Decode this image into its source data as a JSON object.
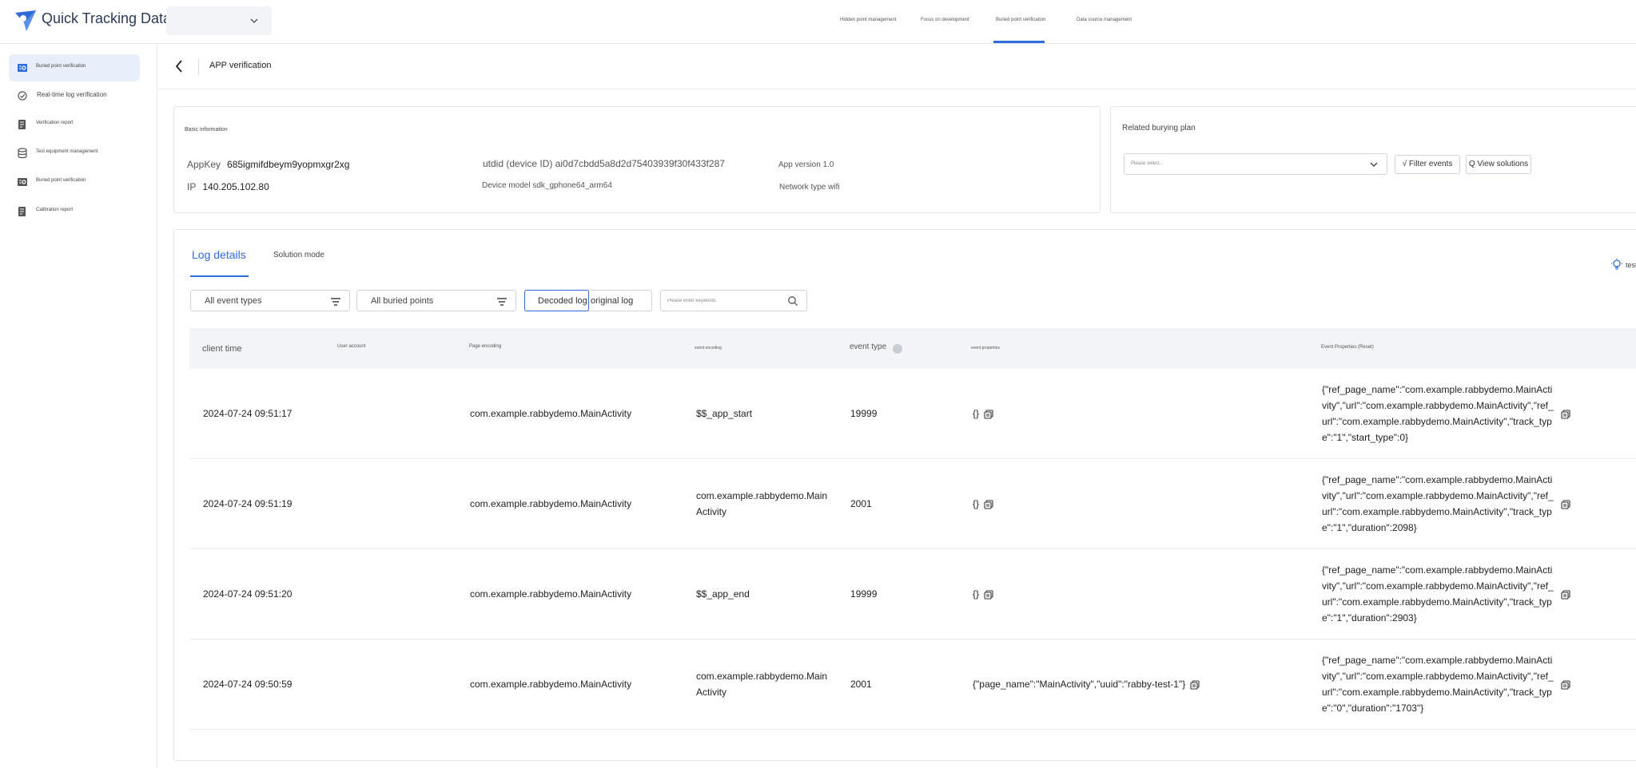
{
  "app": {
    "title": "Quick Tracking Data Collection"
  },
  "topnav": {
    "items": [
      {
        "label": "Hidden point management"
      },
      {
        "label": "Focus on development"
      },
      {
        "label": "Buried point verification"
      },
      {
        "label": "Data source management"
      }
    ],
    "active_index": 2
  },
  "sidebar": {
    "items": [
      {
        "label": "Buried point verification"
      },
      {
        "label": "Real-time log verification"
      },
      {
        "label": "Verification report"
      },
      {
        "label": "Test equipment management"
      },
      {
        "label": "Buried point verification"
      },
      {
        "label": "Calibration report"
      }
    ],
    "active_index": 0
  },
  "page": {
    "title": "APP verification"
  },
  "basic_info": {
    "title": "Basic information",
    "appkey_label": "AppKey",
    "appkey_value": "685igmifdbeym9yopmxgr2xg",
    "ip_label": "IP",
    "ip_value": "140.205.102.80",
    "utdid": "utdid (device ID) ai0d7cbdd5a8d2d75403939f30f433f287",
    "device_model": "Device model sdk_gphone64_arm64",
    "app_version": "App version 1.0",
    "network": "Network type wifi"
  },
  "plan": {
    "title": "Related burying plan",
    "select_placeholder": "Please select...",
    "filter_button": "√ Filter events",
    "view_button": "Q View solutions"
  },
  "log": {
    "tabs": [
      {
        "label": "Log details"
      },
      {
        "label": "Solution mode"
      }
    ],
    "filters": {
      "event_types": "All event types",
      "buried_points": "All buried points",
      "decoded": "Decoded log",
      "original": "original log",
      "search_placeholder": "Please enter keywords"
    },
    "tip_text": "test",
    "columns": [
      {
        "label": "client time"
      },
      {
        "label": "User account"
      },
      {
        "label": "Page encoding"
      },
      {
        "label": "event encoding"
      },
      {
        "label": "event type"
      },
      {
        "label": "event properties"
      },
      {
        "label": "Event Properties (Reset)"
      }
    ],
    "rows": [
      {
        "time": "2024-07-24 09:51:17",
        "account": "",
        "page": "com.example.rabbydemo.MainActivity",
        "event": "$$_app_start",
        "type": "19999",
        "props": "{}",
        "reset": "{\"ref_page_name\":\"com.example.rabbydemo.MainActivity\",\"url\":\"com.example.rabbydemo.MainActivity\",\"ref_url\":\"com.example.rabbydemo.MainActivity\",\"track_type\":\"1\",\"start_type\":0}"
      },
      {
        "time": "2024-07-24 09:51:19",
        "account": "",
        "page": "com.example.rabbydemo.MainActivity",
        "event": "com.example.rabbydemo.MainActivity",
        "type": "2001",
        "props": "{}",
        "reset": "{\"ref_page_name\":\"com.example.rabbydemo.MainActivity\",\"url\":\"com.example.rabbydemo.MainActivity\",\"ref_url\":\"com.example.rabbydemo.MainActivity\",\"track_type\":\"1\",\"duration\":2098}"
      },
      {
        "time": "2024-07-24 09:51:20",
        "account": "",
        "page": "com.example.rabbydemo.MainActivity",
        "event": "$$_app_end",
        "type": "19999",
        "props": "{}",
        "reset": "{\"ref_page_name\":\"com.example.rabbydemo.MainActivity\",\"url\":\"com.example.rabbydemo.MainActivity\",\"ref_url\":\"com.example.rabbydemo.MainActivity\",\"track_type\":\"1\",\"duration\":2903}"
      },
      {
        "time": "2024-07-24 09:50:59",
        "account": "",
        "page": "com.example.rabbydemo.MainActivity",
        "event": "com.example.rabbydemo.MainActivity",
        "type": "2001",
        "props": "{\"page_name\":\"MainActivity\",\"uuid\":\"rabby-test-1\"}",
        "reset": "{\"ref_page_name\":\"com.example.rabbydemo.MainActivity\",\"url\":\"com.example.rabbydemo.MainActivity\",\"ref_url\":\"com.example.rabbydemo.MainActivity\",\"track_type\":\"0\",\"duration\":\"1703\"}"
      }
    ]
  },
  "colors": {
    "accent": "#2f6bd9",
    "active_bg": "#e8effb",
    "table_header": "#f3f4f7"
  }
}
